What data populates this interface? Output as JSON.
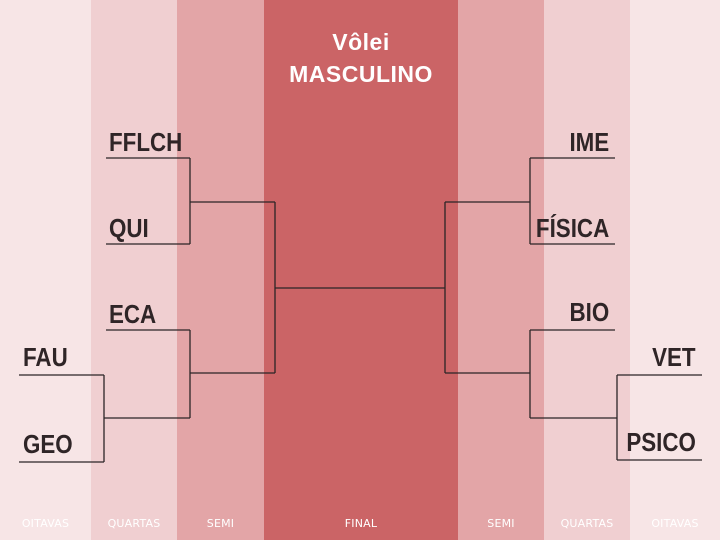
{
  "title": {
    "line1": "Vôlei",
    "line2": "MASCULINO"
  },
  "columns": {
    "oitavas_left": "OITAVAS",
    "quartas_left": "QUARTAS",
    "semi_left": "SEMI",
    "final": "FINAL",
    "semi_right": "SEMI",
    "quartas_right": "QUARTAS",
    "oitavas_right": "OITAVAS"
  },
  "left": {
    "oitavas": [
      "FAU",
      "GEO"
    ],
    "quartas": [
      "FFLCH",
      "QUI",
      "ECA"
    ]
  },
  "right": {
    "oitavas": [
      "VET",
      "PSICO"
    ],
    "quartas": [
      "IME",
      "FÍSICA",
      "BIO"
    ]
  },
  "colors": {
    "oitavas": "#f7e5e6",
    "quartas": "#f0cfd1",
    "semi": "#e3a5a7",
    "final": "#cb6466",
    "line": "#2b2526"
  }
}
